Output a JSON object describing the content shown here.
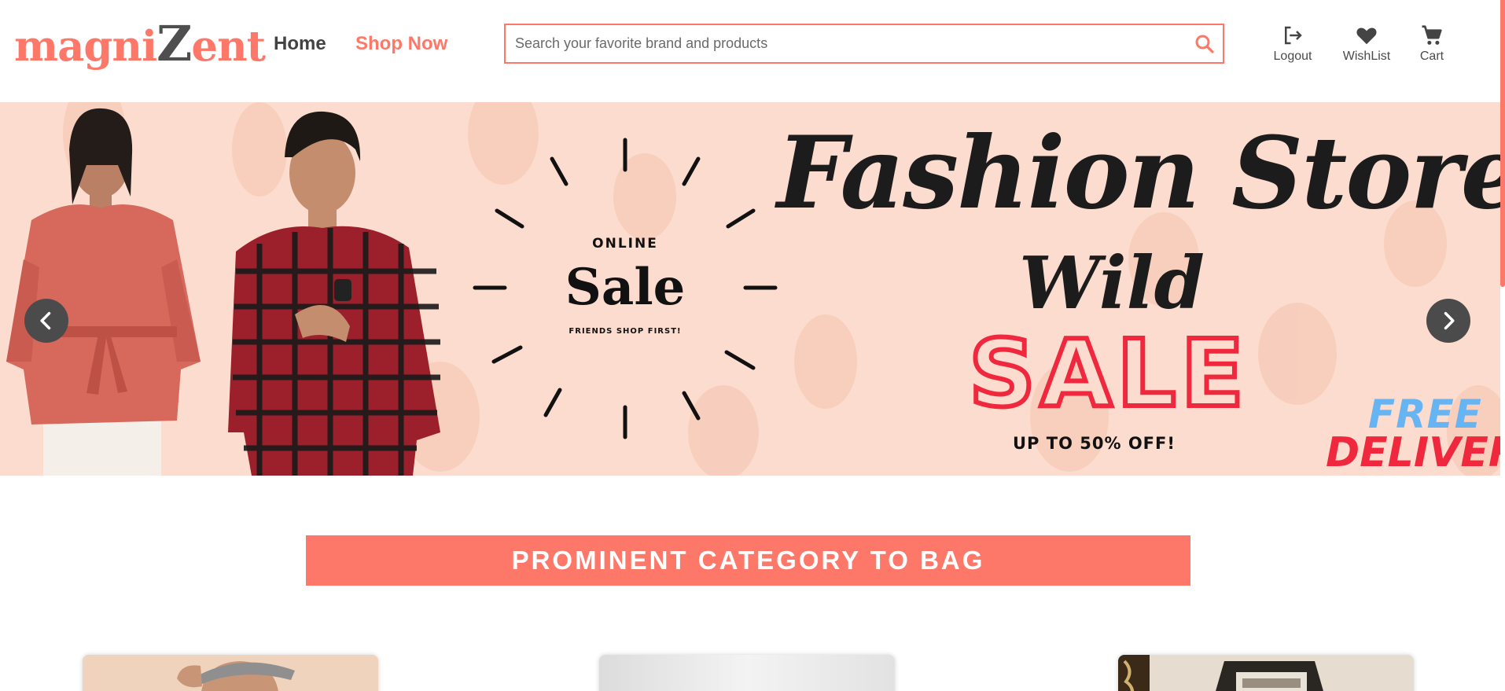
{
  "header": {
    "logo": {
      "part1": "magni",
      "part2": "Z",
      "part3": "ent"
    },
    "nav": {
      "home": "Home",
      "shop_now": "Shop Now"
    },
    "search": {
      "placeholder": "Search your favorite brand and products",
      "value": "",
      "icon": "search-icon"
    },
    "actions": {
      "logout": {
        "label": "Logout",
        "icon": "logout-icon"
      },
      "wishlist": {
        "label": "WishList",
        "icon": "heart-icon"
      },
      "cart": {
        "label": "Cart",
        "icon": "cart-icon"
      }
    }
  },
  "banner": {
    "title": "Fashion Store",
    "badge": {
      "top": "ONLINE",
      "main": "Sale",
      "sub": "FRIENDS SHOP FIRST!"
    },
    "promo": {
      "line1": "Wild",
      "line2": "SALE",
      "line3": "UP TO 50% OFF!"
    },
    "delivery": {
      "line1": "FREE",
      "line2": "DELIVERY"
    },
    "prev_icon": "chevron-left-icon",
    "next_icon": "chevron-right-icon"
  },
  "category": {
    "title": "PROMINENT CATEGORY TO BAG"
  },
  "colors": {
    "accent": "#fd7868",
    "text_dark": "#424242",
    "banner_bg": "#fcdccf",
    "sale_red": "#f0283d",
    "free_blue": "#67b4f3"
  }
}
